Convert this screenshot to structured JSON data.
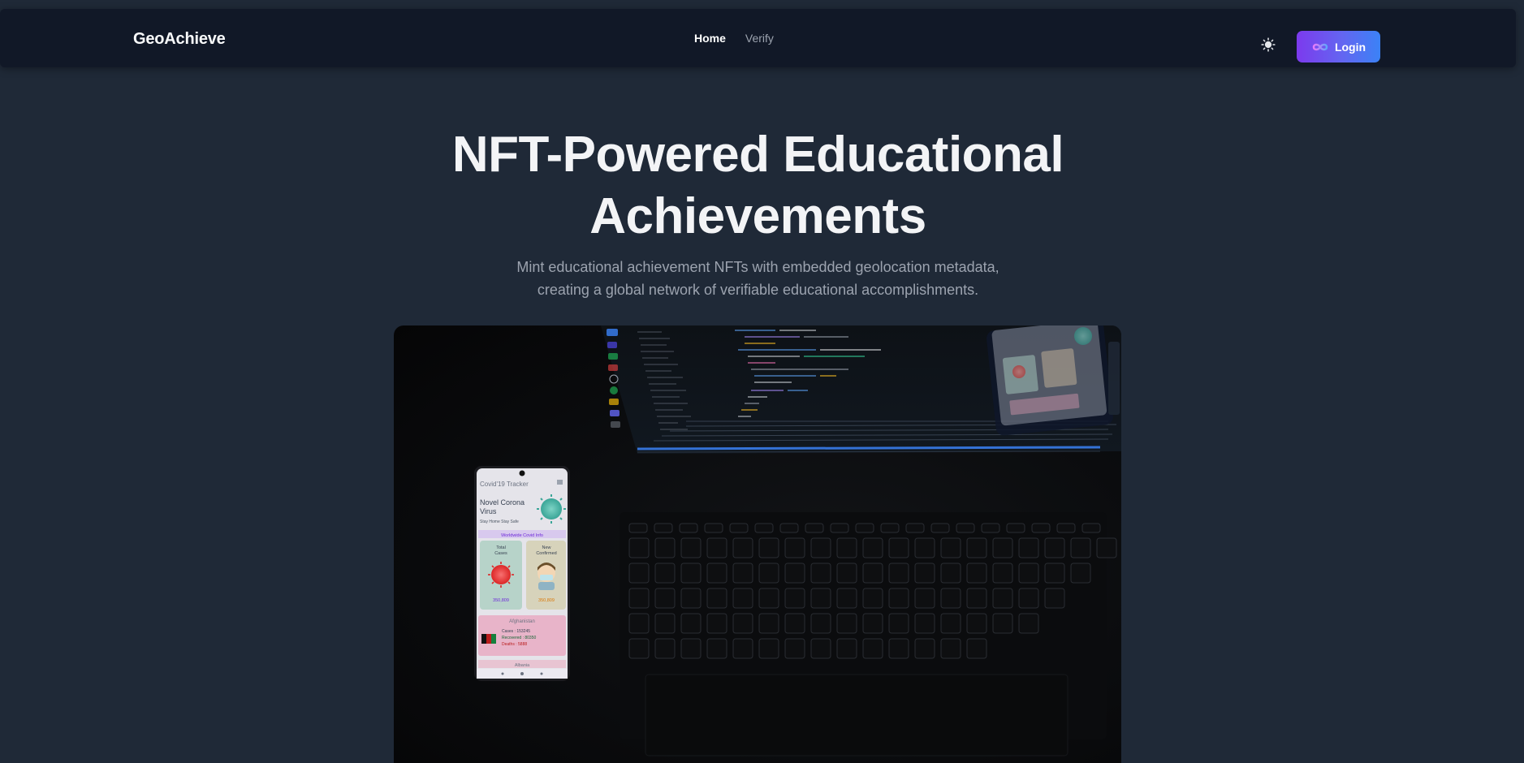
{
  "brand": "GeoAchieve",
  "nav": {
    "links": [
      {
        "label": "Home",
        "active": true
      },
      {
        "label": "Verify",
        "active": false
      }
    ],
    "theme_icon": "sun-icon",
    "login_label": "Login",
    "login_icon": "infinity-icon"
  },
  "hero": {
    "title_line1": "NFT-Powered Educational",
    "title_line2": "Achievements",
    "subtitle_line1": "Mint educational achievement NFTs with embedded geolocation metadata,",
    "subtitle_line2": "creating a global network of verifiable educational accomplishments."
  },
  "photo": {
    "phone": {
      "app_title": "Covid'19 Tracker",
      "headline_line1": "Novel Corona",
      "headline_line2": "Virus",
      "tagline": "Stay Home Stay Safe",
      "section": "Worldwide Covid Info",
      "card1_label_line1": "Total",
      "card1_label_line2": "Cases",
      "card1_value": "350,809",
      "card2_label_line1": "New",
      "card2_label_line2": "Confirmed",
      "card2_value": "350,809",
      "country": "Afghanistan",
      "cases": "Cases : 153245",
      "recovered": "Recovered : 80350",
      "deaths": "Deaths : 5888",
      "next_country": "Albania"
    }
  },
  "colors": {
    "page_bg": "#1f2937",
    "nav_bg": "#111827",
    "accent_from": "#7c3aed",
    "accent_to": "#3b82f6"
  }
}
